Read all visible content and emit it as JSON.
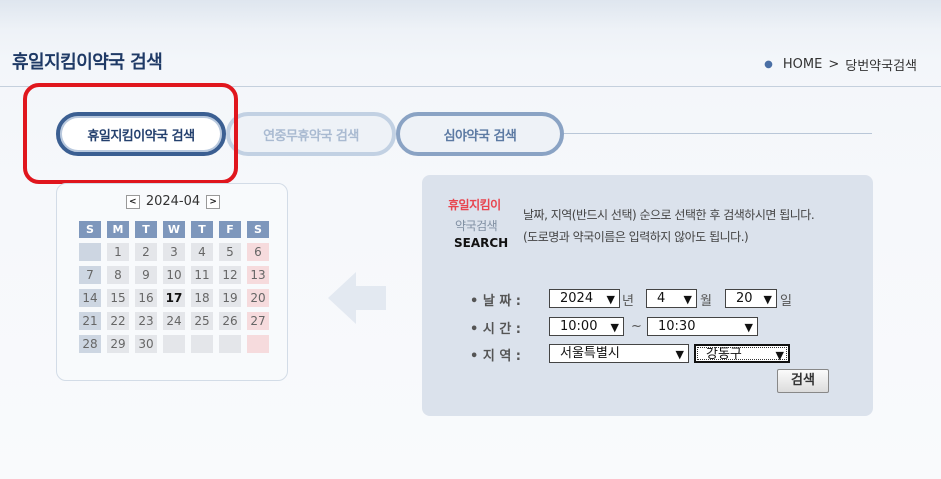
{
  "page": {
    "title": "휴일지킴이약국 검색",
    "breadcrumb": {
      "home": "HOME",
      "separator": ">",
      "current": "당번약국검색"
    }
  },
  "tabs": [
    {
      "label": "휴일지킴이약국 검색",
      "active": true
    },
    {
      "label": "연중무휴약국 검색",
      "active": false
    },
    {
      "label": "심야약국 검색",
      "active": false
    }
  ],
  "calendar": {
    "month_label": "2024-04",
    "prev": "<",
    "next": ">",
    "weekdays": [
      "S",
      "M",
      "T",
      "W",
      "T",
      "F",
      "S"
    ],
    "weeks": [
      [
        "",
        "1",
        "2",
        "3",
        "4",
        "5",
        "6"
      ],
      [
        "7",
        "8",
        "9",
        "10",
        "11",
        "12",
        "13"
      ],
      [
        "14",
        "15",
        "16",
        "17",
        "18",
        "19",
        "20"
      ],
      [
        "21",
        "22",
        "23",
        "24",
        "25",
        "26",
        "27"
      ],
      [
        "28",
        "29",
        "30",
        "",
        "",
        "",
        ""
      ]
    ],
    "today": "17"
  },
  "search": {
    "label_line1": "휴일지킴이",
    "label_line2": "약국검색",
    "label_line3": "SEARCH",
    "desc_line1": "날짜, 지역(반드시 선택) 순으로 선택한 후 검색하시면 됩니다.",
    "desc_line2": "(도로명과 약국이름은 입력하지 않아도 됩니다.)",
    "date_label": "• 날 짜 :",
    "time_label": "• 시 간 :",
    "region_label": "• 지 역 :",
    "year": "2024",
    "year_unit": "년",
    "month": "4",
    "month_unit": "월",
    "day": "20",
    "day_unit": "일",
    "time_from": "10:00",
    "time_sep": "~",
    "time_to": "10:30",
    "city": "서울특별시",
    "district": "강동구",
    "button": "검색"
  },
  "colors": {
    "accent": "#3b5f92",
    "highlight": "#e0161d",
    "panel": "#dbe2ec"
  }
}
